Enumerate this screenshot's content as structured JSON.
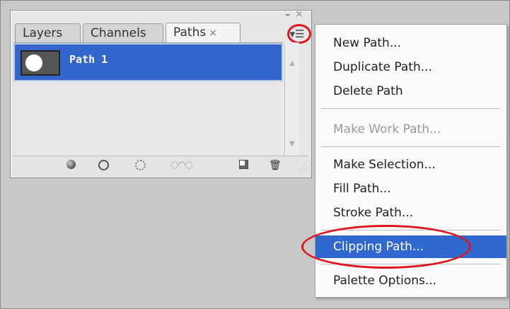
{
  "panel": {
    "minimize_glyph": "–",
    "close_glyph": "×",
    "tabs": [
      {
        "label": "Layers"
      },
      {
        "label": "Channels"
      },
      {
        "label": "Paths",
        "close": "×"
      }
    ],
    "menu_button_glyph": "▾☰",
    "paths": [
      {
        "name": "Path 1",
        "selected": true
      }
    ],
    "footer_icons": [
      "fill-path-icon",
      "stroke-path-icon",
      "load-selection-icon",
      "make-work-path-icon",
      "new-path-icon",
      "delete-path-icon"
    ]
  },
  "menu": {
    "items": [
      {
        "label": "New Path..."
      },
      {
        "label": "Duplicate Path..."
      },
      {
        "label": "Delete Path"
      },
      {
        "label": "Make Work Path...",
        "disabled": true
      },
      {
        "label": "Make Selection..."
      },
      {
        "label": "Fill Path..."
      },
      {
        "label": "Stroke Path..."
      },
      {
        "label": "Clipping Path...",
        "highlighted": true
      },
      {
        "label": "Palette Options..."
      }
    ]
  },
  "colors": {
    "selection": "#3366cc",
    "menu_highlight": "#3168d0",
    "annotation": "#e0141c"
  }
}
